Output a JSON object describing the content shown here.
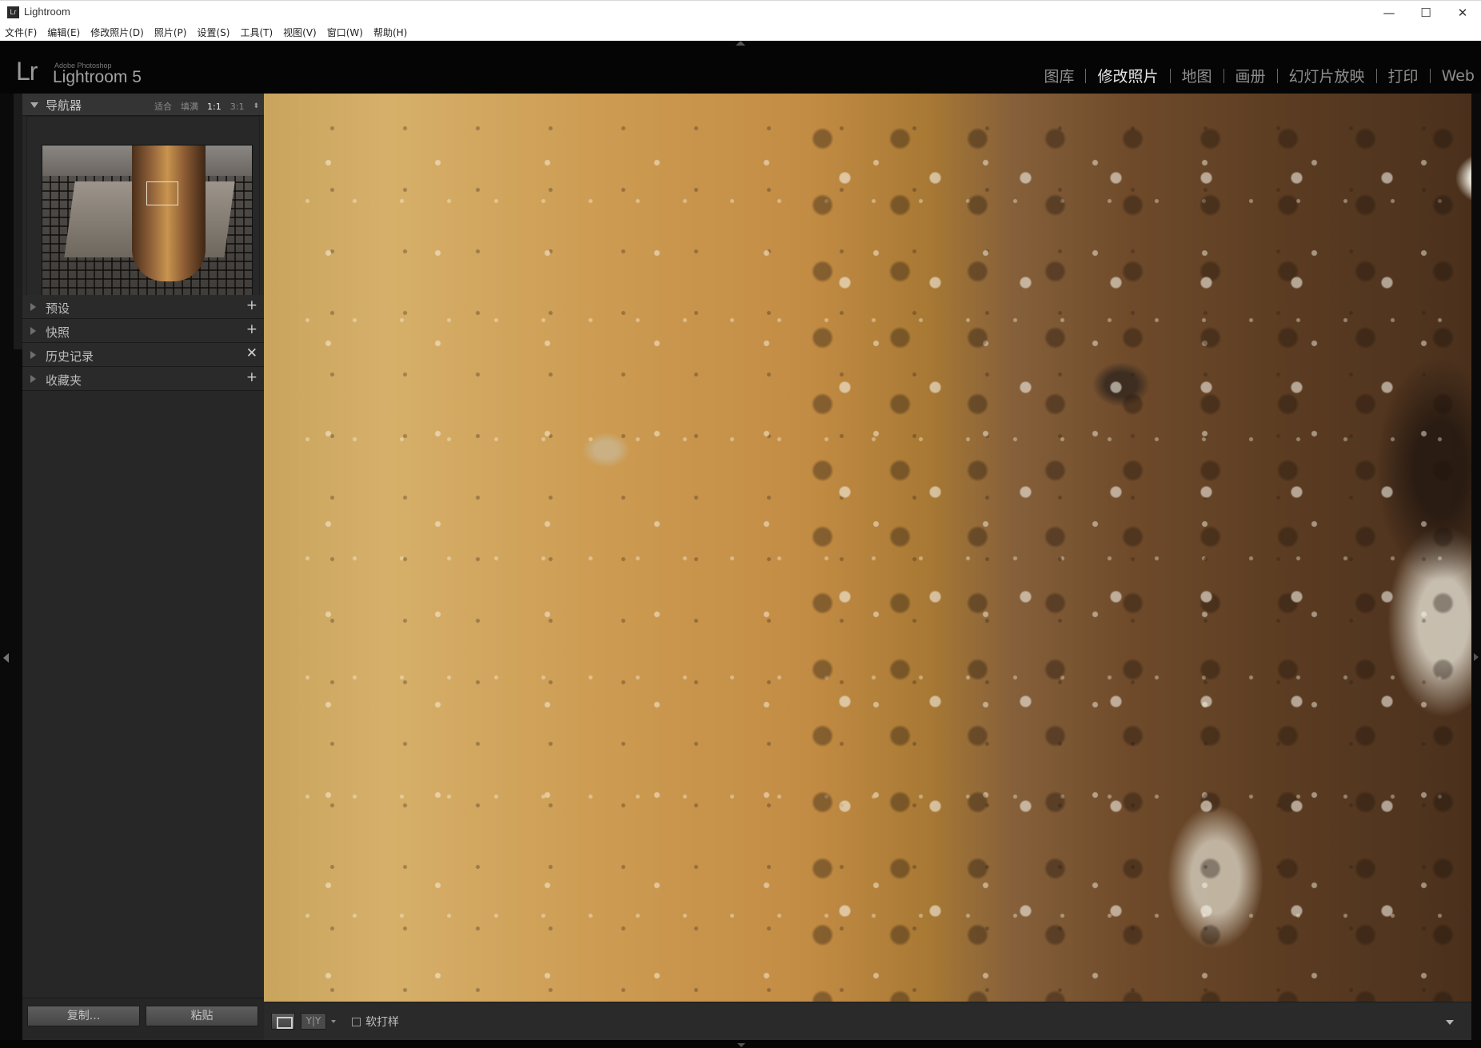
{
  "window": {
    "app_icon_text": "Lr",
    "title": "Lightroom",
    "controls": {
      "minimize": "—",
      "maximize": "☐",
      "close": "✕"
    }
  },
  "menu": {
    "items": [
      "文件(F)",
      "编辑(E)",
      "修改照片(D)",
      "照片(P)",
      "设置(S)",
      "工具(T)",
      "视图(V)",
      "窗口(W)",
      "帮助(H)"
    ]
  },
  "identity": {
    "logo": "Lr",
    "brand_small": "Adobe Photoshop",
    "product": "Lightroom 5"
  },
  "modules": {
    "items": [
      "图库",
      "修改照片",
      "地图",
      "画册",
      "幻灯片放映",
      "打印",
      "Web"
    ],
    "active": "修改照片"
  },
  "navigator": {
    "title": "导航器",
    "zoom_options": [
      "适合",
      "填满",
      "1:1",
      "3:1"
    ],
    "selected_zoom": "1:1",
    "zoom_arrows": "⬍"
  },
  "panels": [
    {
      "label": "预设",
      "action": "+"
    },
    {
      "label": "快照",
      "action": "+"
    },
    {
      "label": "历史记录",
      "action": "✕"
    },
    {
      "label": "收藏夹",
      "action": "+"
    }
  ],
  "left_buttons": {
    "copy": "复制...",
    "paste": "粘贴"
  },
  "toolbar": {
    "before_after": "Y|Y",
    "soft_proof": "软打样",
    "soft_proof_checked": false
  },
  "icons": {
    "titlebar": "lightroom-app-icon",
    "navigator_toggle": "triangle-down-icon",
    "panel_toggle": "triangle-right-icon",
    "view_mode": "loupe-view-icon",
    "toolbar_menu": "chevron-down-icon"
  }
}
